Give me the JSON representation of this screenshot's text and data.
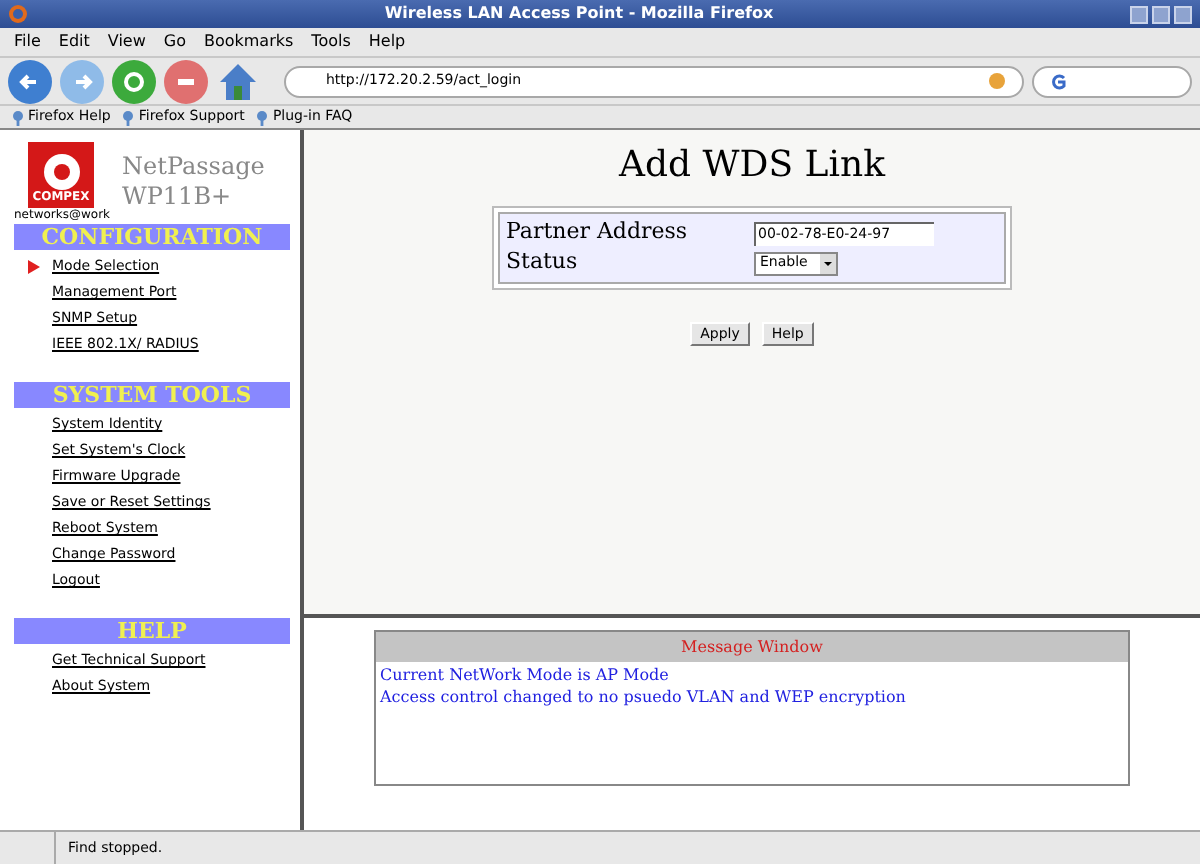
{
  "window": {
    "title": "Wireless LAN Access Point - Mozilla Firefox"
  },
  "menu": [
    "File",
    "Edit",
    "View",
    "Go",
    "Bookmarks",
    "Tools",
    "Help"
  ],
  "address_bar": {
    "value": "http://172.20.2.59/act_login"
  },
  "bookmarks": [
    "Firefox Help",
    "Firefox Support",
    "Plug-in FAQ"
  ],
  "sidebar": {
    "logo": {
      "brand": "COMPEX",
      "tagline": "networks@work"
    },
    "product": [
      "NetPassage",
      "WP11B+"
    ],
    "sections": [
      {
        "title": "CONFIGURATION",
        "items": [
          {
            "label": "Mode Selection",
            "selected": true
          },
          {
            "label": "Management Port",
            "selected": false
          },
          {
            "label": "SNMP Setup",
            "selected": false
          },
          {
            "label": "IEEE 802.1X/ RADIUS",
            "selected": false
          }
        ]
      },
      {
        "title": "SYSTEM TOOLS",
        "items": [
          {
            "label": "System Identity",
            "selected": false
          },
          {
            "label": "Set System's Clock",
            "selected": false
          },
          {
            "label": "Firmware Upgrade",
            "selected": false
          },
          {
            "label": "Save or Reset Settings",
            "selected": false
          },
          {
            "label": "Reboot System",
            "selected": false
          },
          {
            "label": "Change Password",
            "selected": false
          },
          {
            "label": "Logout",
            "selected": false
          }
        ]
      },
      {
        "title": "HELP",
        "items": [
          {
            "label": "Get Technical Support",
            "selected": false
          },
          {
            "label": "About System",
            "selected": false
          }
        ]
      }
    ]
  },
  "form": {
    "title": "Add WDS Link",
    "fields": [
      {
        "kind": "text",
        "label": "Partner Address",
        "value": "00-02-78-E0-24-97"
      },
      {
        "kind": "select",
        "label": "Status",
        "value": "Enable"
      }
    ],
    "buttons": [
      "Apply",
      "Help"
    ]
  },
  "message_window": {
    "title": "Message Window",
    "lines": [
      "Current NetWork Mode is AP Mode",
      "Access control changed to no psuedo VLAN and WEP encryption"
    ]
  },
  "status_bar": {
    "text": "Find stopped."
  }
}
